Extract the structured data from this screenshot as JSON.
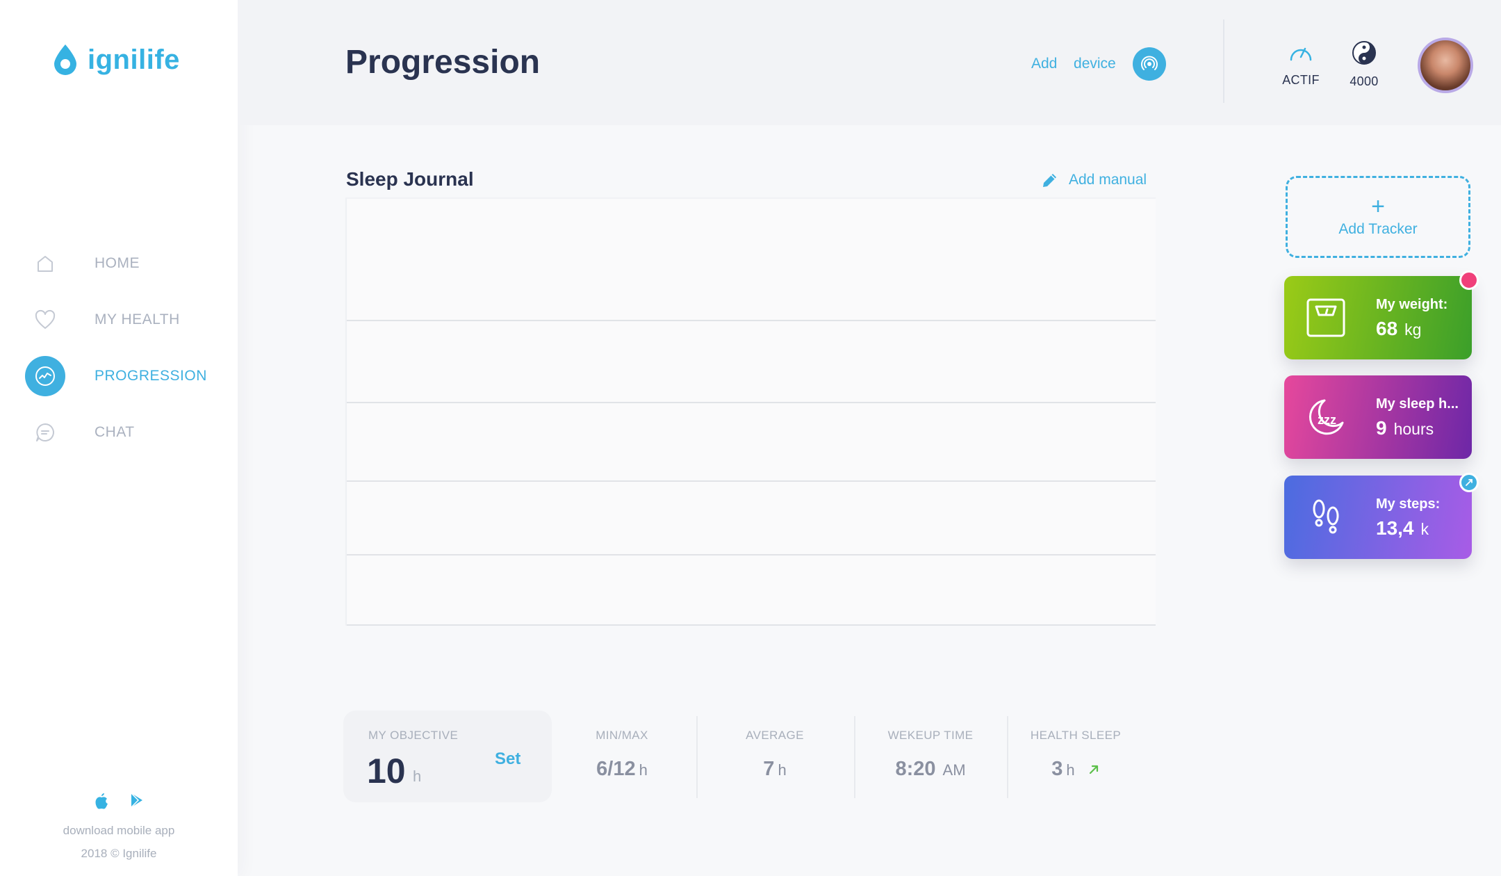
{
  "brand": {
    "name": "ignilife",
    "color": "#36b2e2"
  },
  "sidebar": {
    "items": [
      {
        "label": "HOME",
        "icon": "home-icon",
        "active": false
      },
      {
        "label": "MY HEALTH",
        "icon": "heart-icon",
        "active": false
      },
      {
        "label": "PROGRESSION",
        "icon": "progression-chart-icon",
        "active": true
      },
      {
        "label": "CHAT",
        "icon": "chat-bubble-icon",
        "active": false
      }
    ],
    "footer": {
      "download_text": "download mobile app",
      "copyright": "2018 © Ignilife",
      "store_icons": [
        "apple-icon",
        "google-play-icon"
      ]
    }
  },
  "header": {
    "title": "Progression",
    "add_device_label": "Add  device",
    "status": {
      "label": "ACTIF",
      "icon": "speedometer-icon"
    },
    "points": {
      "value": "4000",
      "icon": "yin-yang-icon"
    }
  },
  "journal": {
    "title": "Sleep Journal",
    "add_manual_label": "Add manual"
  },
  "stats": {
    "objective": {
      "label": "MY OBJECTIVE",
      "value": "10",
      "unit": "h",
      "action": "Set"
    },
    "minmax": {
      "label": "MIN/MAX",
      "value": "6/12",
      "unit": "h"
    },
    "average": {
      "label": "AVERAGE",
      "value": "7",
      "unit": "h"
    },
    "wakeup": {
      "label": "WEKEUP TIME",
      "value": "8:20",
      "unit": "AM"
    },
    "health_sleep": {
      "label": "HEALTH SLEEP",
      "value": "3",
      "unit": "h",
      "trend": "up"
    }
  },
  "trackers": {
    "add_label": "Add Tracker",
    "add_symbol": "+",
    "weight": {
      "title": "My weight:",
      "value": "68",
      "unit": "kg",
      "icon": "scale-icon",
      "badge_color": "#f0407a"
    },
    "sleep": {
      "title": "My sleep h...",
      "value": "9",
      "unit": "hours",
      "icon": "moon-zzz-icon"
    },
    "steps": {
      "title": "My steps:",
      "value": "13,4",
      "unit": "k",
      "icon": "footprints-icon",
      "badge_color": "#3fb0e0"
    }
  },
  "colors": {
    "accent": "#3fb0e0",
    "text_dark": "#2a3350",
    "muted": "#a8afbb"
  }
}
